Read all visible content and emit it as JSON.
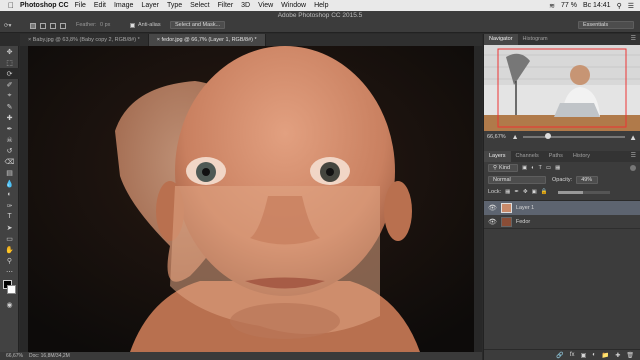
{
  "menubar": {
    "app_name": "Photoshop CC",
    "items": [
      "File",
      "Edit",
      "Image",
      "Layer",
      "Type",
      "Select",
      "Filter",
      "3D",
      "View",
      "Window",
      "Help"
    ],
    "battery": "77 %",
    "clock": "Вс 14:41"
  },
  "window": {
    "title": "Adobe Photoshop CC 2015.5"
  },
  "options": {
    "feather_label": "Feather:",
    "feather_value": "0 px",
    "antialias_label": "Anti-alias",
    "select_mask_label": "Select and Mask...",
    "workspace": "Essentials"
  },
  "doc_tabs": [
    {
      "label": "Baby.jpg @ 63,8% (Baby copy 2, RGB/8#) *"
    },
    {
      "label": "fedor.jpg @ 66,7% (Layer 1, RGB/8#) *"
    }
  ],
  "status": {
    "zoom": "66,67%",
    "doc": "Doc: 16,8M/34,2M"
  },
  "navigator": {
    "tabs": [
      "Navigator",
      "Histogram"
    ],
    "zoom": "66,67%"
  },
  "layers_panel": {
    "tabs": [
      "Layers",
      "Channels",
      "Paths",
      "History"
    ],
    "filter_label": "Kind",
    "blend_mode": "Normal",
    "opacity_label": "Opacity:",
    "opacity_value": "49%",
    "opacity_fraction": 0.49,
    "lock_label": "Lock:",
    "fill_label": "Fill:",
    "layers": [
      {
        "name": "Layer 1",
        "selected": true
      },
      {
        "name": "Fedor",
        "selected": false
      }
    ]
  },
  "colors": {
    "accent": "#5a8de0",
    "menubar_bg": "#e9e9e9",
    "panel_bg": "#3c3c3c"
  }
}
